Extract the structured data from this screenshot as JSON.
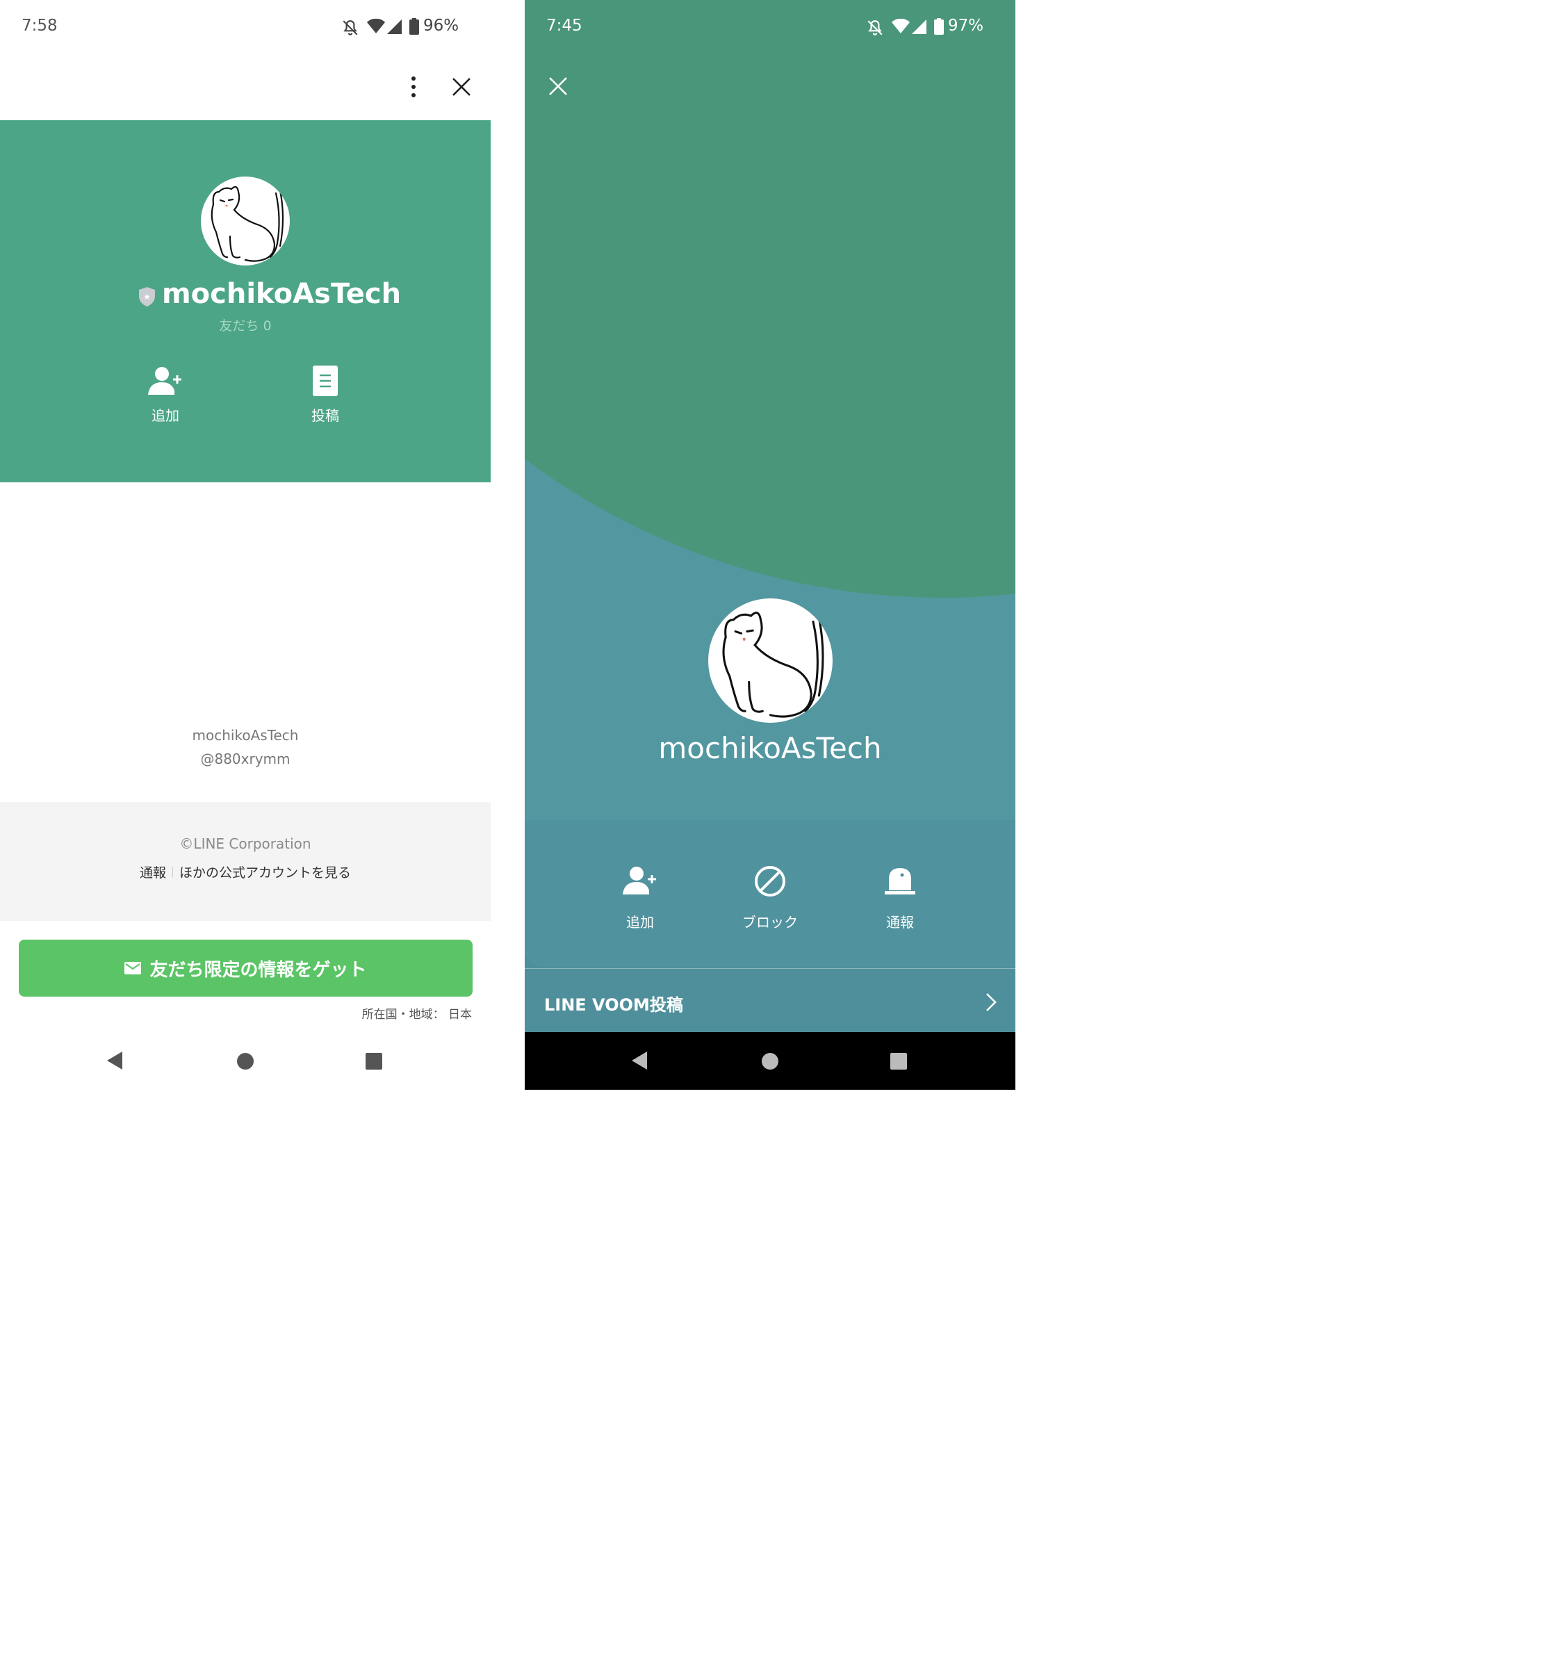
{
  "left": {
    "status_bar": {
      "time": "7:58",
      "battery": "96%"
    },
    "profile": {
      "name": "mochikoAsTech",
      "friends": "友だち 0"
    },
    "actions": [
      {
        "label": "追加",
        "icon": "add-friend-icon"
      },
      {
        "label": "投稿",
        "icon": "post-icon"
      }
    ],
    "account_info": {
      "name": "mochikoAsTech",
      "id": "@880xrymm"
    },
    "footer": {
      "copyright": "©LINE Corporation",
      "report": "通報",
      "other_accounts": "ほかの公式アカウントを見る"
    },
    "cta": {
      "label": "友だち限定の情報をゲット",
      "icon": "mail-icon"
    },
    "region": "所在国・地域： 日本"
  },
  "right": {
    "status_bar": {
      "time": "7:45",
      "battery": "97%"
    },
    "profile": {
      "name": "mochikoAsTech"
    },
    "actions": [
      {
        "label": "追加",
        "icon": "add-friend-icon"
      },
      {
        "label": "ブロック",
        "icon": "block-icon"
      },
      {
        "label": "通報",
        "icon": "report-icon"
      }
    ],
    "voom": {
      "label": "LINE VOOM投稿"
    }
  },
  "colors": {
    "left_header": "#4ca586",
    "cta_button": "#5bc466",
    "right_bg_green": "#4a967a",
    "right_bg_teal": "#4f8f9b"
  }
}
